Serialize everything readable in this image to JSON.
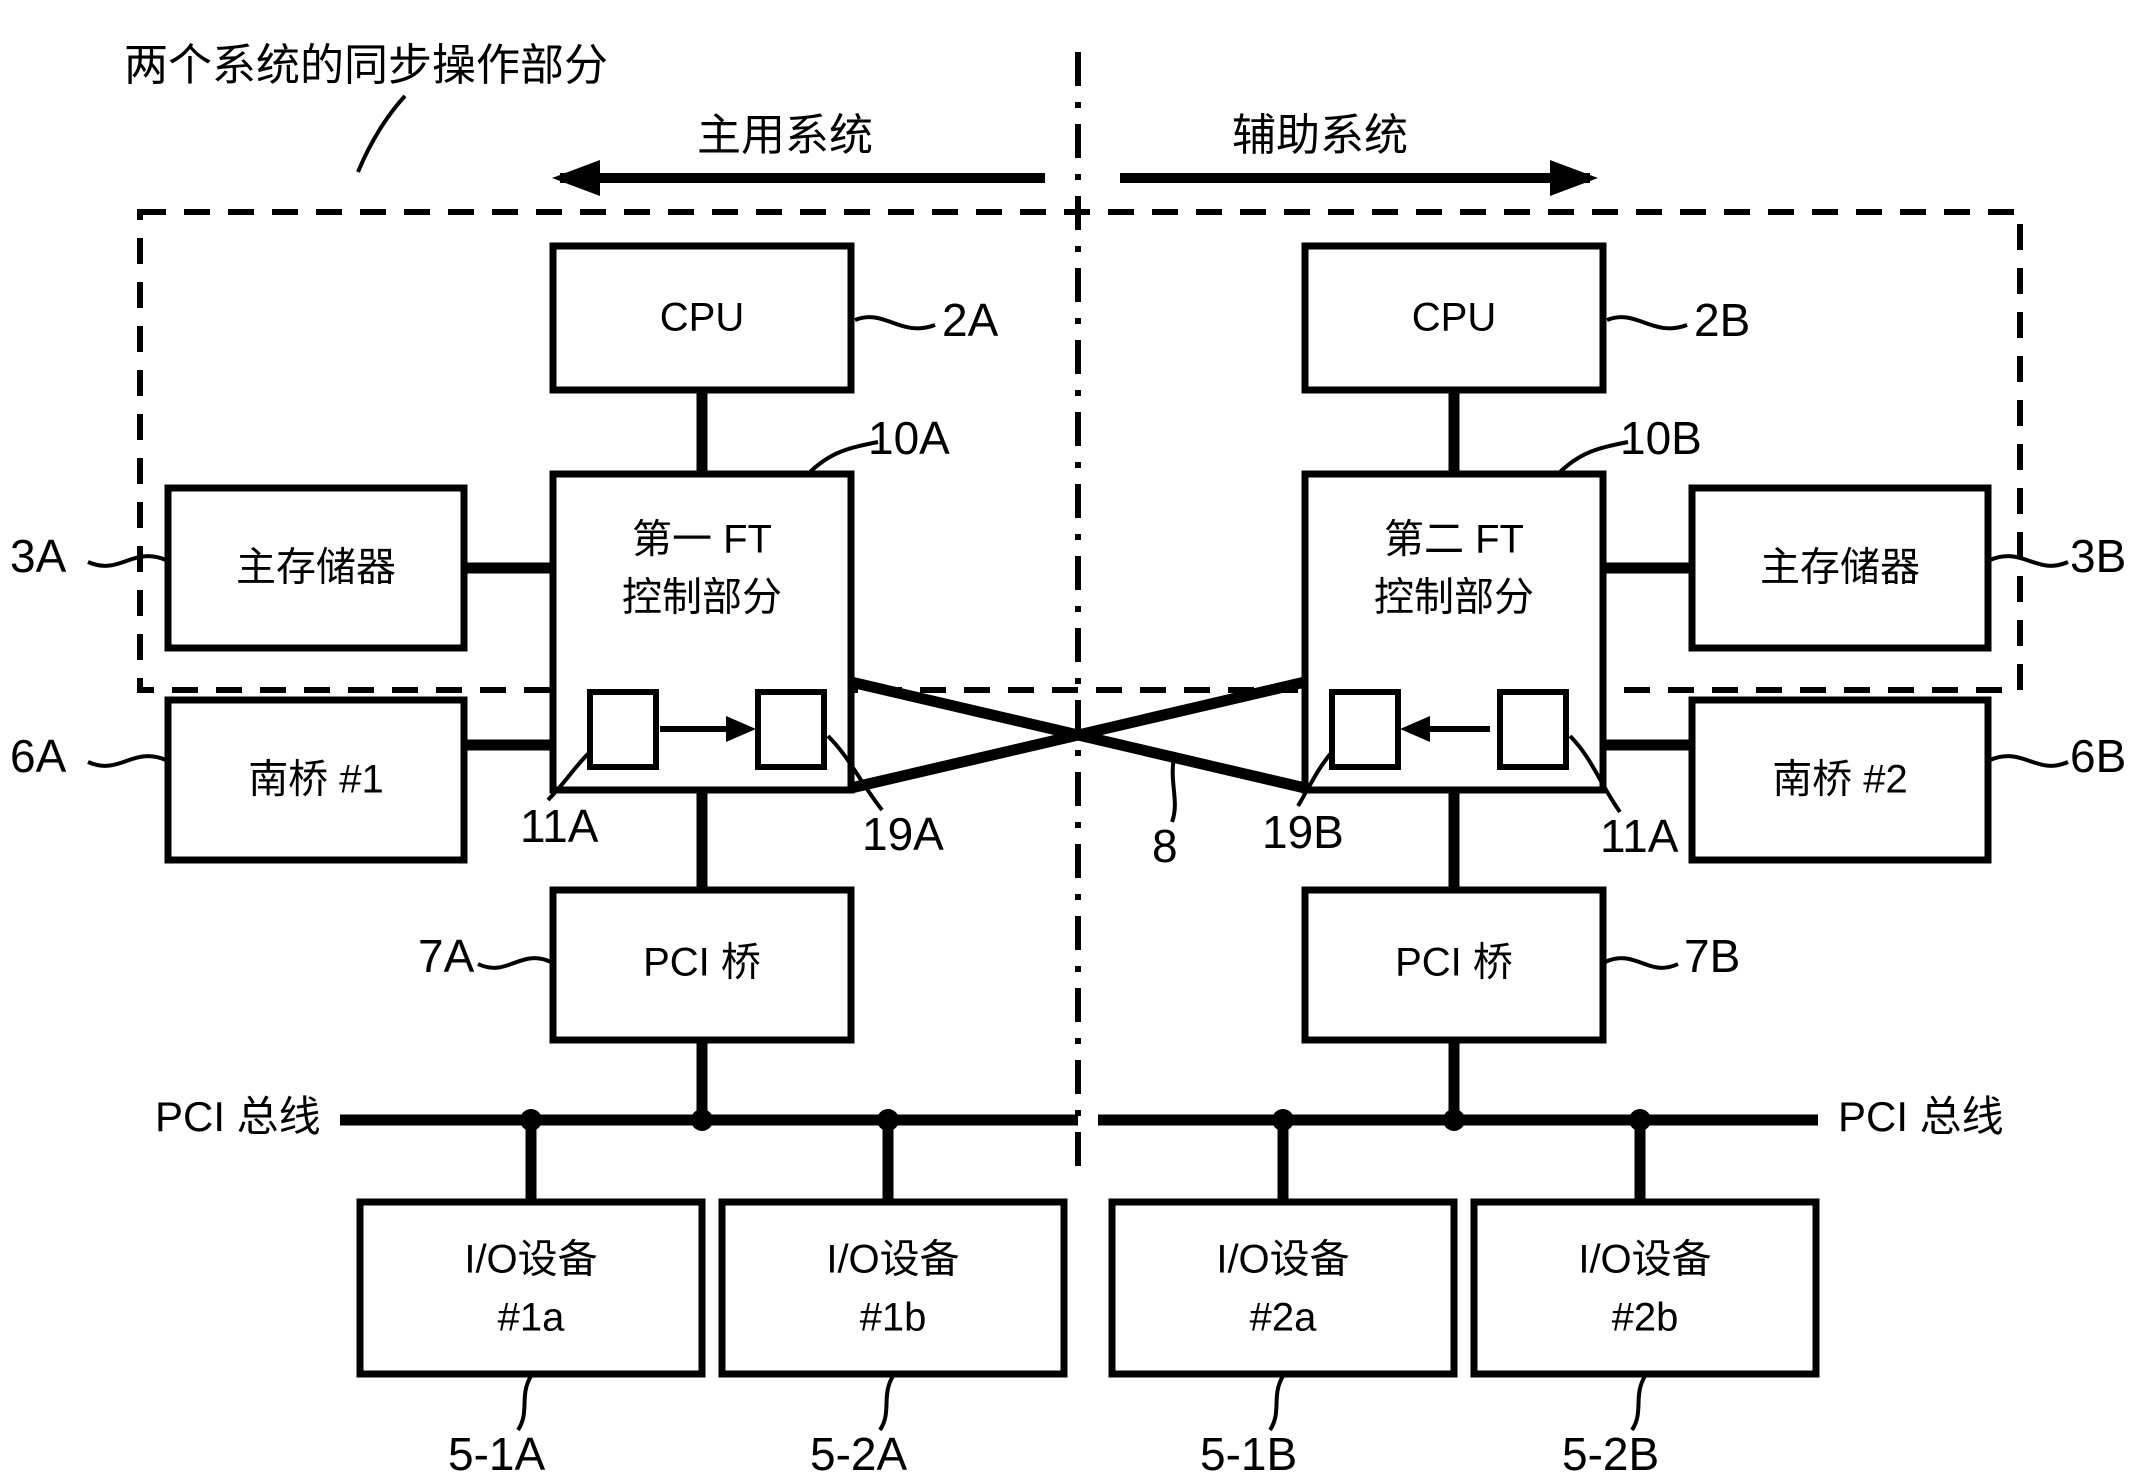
{
  "figure": {
    "title": "两个系统的同步操作部分",
    "systems": {
      "left_label": "主用系统",
      "right_label": "辅助系统"
    },
    "bus_label_left": "PCI 总线",
    "bus_label_right": "PCI 总线",
    "blocks": {
      "cpu_a": {
        "label": "CPU",
        "ref": "2A"
      },
      "cpu_b": {
        "label": "CPU",
        "ref": "2B"
      },
      "ft_a_line1": "第一 FT",
      "ft_a_line2": "控制部分",
      "ft_a_ref": "10A",
      "ft_b_line1": "第二 FT",
      "ft_b_line2": "控制部分",
      "ft_b_ref": "10B",
      "mem_a": {
        "label": "主存储器",
        "ref": "3A"
      },
      "mem_b": {
        "label": "主存储器",
        "ref": "3B"
      },
      "sb_a": {
        "label": "南桥 #1",
        "ref": "6A"
      },
      "sb_b": {
        "label": "南桥 #2",
        "ref": "6B"
      },
      "pci_bridge_a": {
        "label": "PCI 桥",
        "ref": "7A"
      },
      "pci_bridge_b": {
        "label": "PCI 桥",
        "ref": "7B"
      },
      "io_1a": {
        "line1": "I/O设备",
        "line2": "#1a",
        "ref": "5-1A"
      },
      "io_1b": {
        "line1": "I/O设备",
        "line2": "#1b",
        "ref": "5-2A"
      },
      "io_2a": {
        "line1": "I/O设备",
        "line2": "#2a",
        "ref": "5-1B"
      },
      "io_2b": {
        "line1": "I/O设备",
        "line2": "#2b",
        "ref": "5-2B"
      }
    },
    "inner_refs": {
      "left_buffer_in": "11A",
      "left_buffer_out": "19A",
      "crosslink": "8",
      "right_buffer_in": "19B",
      "right_buffer_out": "11A"
    },
    "colors": {
      "stroke": "#000000",
      "background": "#ffffff"
    }
  }
}
